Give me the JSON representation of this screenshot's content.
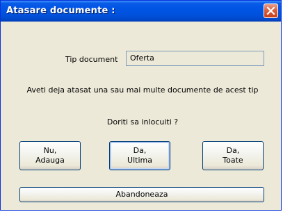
{
  "dialog": {
    "title": "Atasare documente :",
    "close_icon": "close-icon"
  },
  "tip_document": {
    "label": "Tip document",
    "value": "Oferta"
  },
  "message": "Aveti deja atasat una sau mai multe documente de acest tip",
  "question": "Doriti sa inlocuiti ?",
  "buttons": {
    "nu_adauga": [
      "Nu,",
      "Adauga"
    ],
    "da_ultima": [
      "Da,",
      "Ultima"
    ],
    "da_toate": [
      "Da,",
      "Toate"
    ],
    "abandoneaza": "Abandoneaza"
  },
  "colors": {
    "titlebar": "#0055e5",
    "close_button": "#d8603e",
    "dialog_background": "#ece9d8"
  }
}
